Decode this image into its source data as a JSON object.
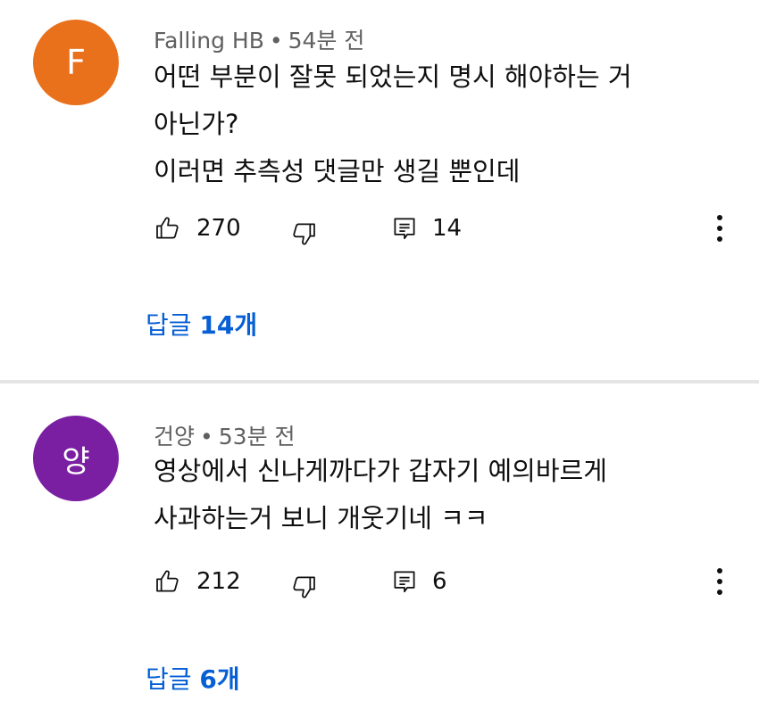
{
  "comments": [
    {
      "avatar_letter": "F",
      "avatar_color": "#e9711c",
      "author": "Falling HB",
      "separator": "•",
      "time": "54분 전",
      "lines": [
        "어떤 부분이 잘못 되었는지 명시 해야하는 거",
        "아닌가?",
        "이러면 추측성 댓글만 생길 뿐인데"
      ],
      "likes": "270",
      "reply_count": "14",
      "replies_prefix": "답글 ",
      "replies_bold": "14개"
    },
    {
      "avatar_letter": "양",
      "avatar_color": "#7b1fa2",
      "author": "건양",
      "separator": "•",
      "time": "53분 전",
      "lines": [
        "영상에서 신나게까다가 갑자기 예의바르게",
        "사과하는거 보니 개웃기네 ㅋㅋ"
      ],
      "likes": "212",
      "reply_count": "6",
      "replies_prefix": "답글 ",
      "replies_bold": "6개"
    }
  ],
  "icons": {
    "like": "thumbs-up-icon",
    "dislike": "thumbs-down-icon",
    "reply": "comment-icon",
    "more": "more-vertical-icon"
  },
  "colors": {
    "link": "#065fd4",
    "meta": "#606060",
    "divider": "#e5e5e5"
  }
}
